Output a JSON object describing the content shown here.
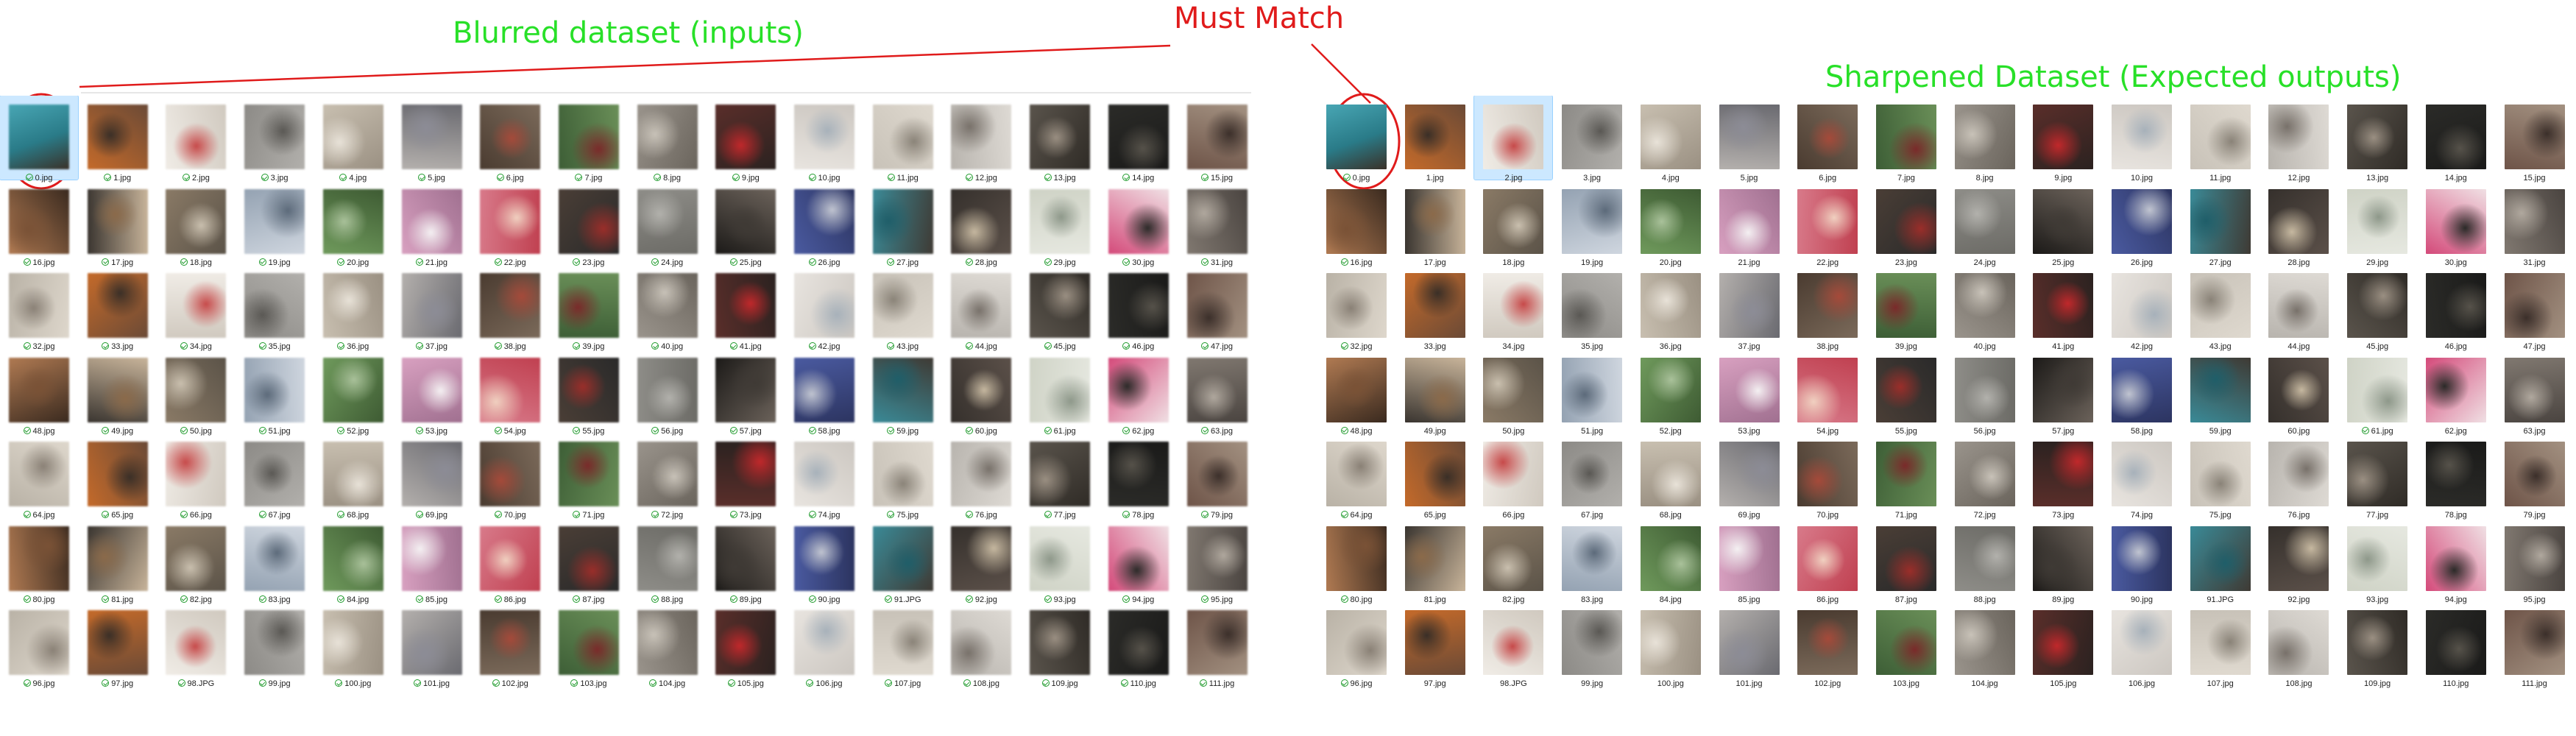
{
  "annotations": {
    "left_title": "Blurred dataset (inputs)",
    "center_title": "Must Match",
    "right_title": "Sharpened Dataset (Expected outputs)",
    "title_color": "#28e028",
    "match_color": "#e01b1b"
  },
  "explorer": {
    "status_icon": "sync-ok-icon",
    "status_color": "#1e9a2b",
    "selection_color": "#cce8ff"
  },
  "blurred_pane": {
    "files": [
      "0.jpg",
      "1.jpg",
      "2.jpg",
      "3.jpg",
      "4.jpg",
      "5.jpg",
      "6.jpg",
      "7.jpg",
      "8.jpg",
      "9.jpg",
      "10.jpg",
      "11.jpg",
      "12.jpg",
      "13.jpg",
      "14.jpg",
      "15.jpg",
      "16.jpg",
      "17.jpg",
      "18.jpg",
      "19.jpg",
      "20.jpg",
      "21.jpg",
      "22.jpg",
      "23.jpg",
      "24.jpg",
      "25.jpg",
      "26.jpg",
      "27.jpg",
      "28.jpg",
      "29.jpg",
      "30.jpg",
      "31.jpg",
      "32.jpg",
      "33.jpg",
      "34.jpg",
      "35.jpg",
      "36.jpg",
      "37.jpg",
      "38.jpg",
      "39.jpg",
      "40.jpg",
      "41.jpg",
      "42.jpg",
      "43.jpg",
      "44.jpg",
      "45.jpg",
      "46.jpg",
      "47.jpg",
      "48.jpg",
      "49.jpg",
      "50.jpg",
      "51.jpg",
      "52.jpg",
      "53.jpg",
      "54.jpg",
      "55.jpg",
      "56.jpg",
      "57.jpg",
      "58.jpg",
      "59.jpg",
      "60.jpg",
      "61.jpg",
      "62.jpg",
      "63.jpg",
      "64.jpg",
      "65.jpg",
      "66.jpg",
      "67.jpg",
      "68.jpg",
      "69.jpg",
      "70.jpg",
      "71.jpg",
      "72.jpg",
      "73.jpg",
      "74.jpg",
      "75.jpg",
      "76.jpg",
      "77.jpg",
      "78.jpg",
      "79.jpg",
      "80.jpg",
      "81.jpg",
      "82.jpg",
      "83.jpg",
      "84.jpg",
      "85.jpg",
      "86.jpg",
      "87.jpg",
      "88.jpg",
      "89.jpg",
      "90.jpg",
      "91.JPG",
      "92.jpg",
      "93.jpg",
      "94.jpg",
      "95.jpg",
      "96.jpg",
      "97.jpg",
      "98.JPG",
      "99.jpg",
      "100.jpg",
      "101.jpg",
      "102.jpg",
      "103.jpg",
      "104.jpg",
      "105.jpg",
      "106.jpg",
      "107.jpg",
      "108.jpg",
      "109.jpg",
      "110.jpg",
      "111.jpg"
    ],
    "selected_index": 0
  },
  "sharpened_pane": {
    "files": [
      "0.jpg",
      "1.jpg",
      "2.jpg",
      "3.jpg",
      "4.jpg",
      "5.jpg",
      "6.jpg",
      "7.jpg",
      "8.jpg",
      "9.jpg",
      "10.jpg",
      "11.jpg",
      "12.jpg",
      "13.jpg",
      "14.jpg",
      "15.jpg",
      "16.jpg",
      "17.jpg",
      "18.jpg",
      "19.jpg",
      "20.jpg",
      "21.jpg",
      "22.jpg",
      "23.jpg",
      "24.jpg",
      "25.jpg",
      "26.jpg",
      "27.jpg",
      "28.jpg",
      "29.jpg",
      "30.jpg",
      "31.jpg",
      "32.jpg",
      "33.jpg",
      "34.jpg",
      "35.jpg",
      "36.jpg",
      "37.jpg",
      "38.jpg",
      "39.jpg",
      "40.jpg",
      "41.jpg",
      "42.jpg",
      "43.jpg",
      "44.jpg",
      "45.jpg",
      "46.jpg",
      "47.jpg",
      "48.jpg",
      "49.jpg",
      "50.jpg",
      "51.jpg",
      "52.jpg",
      "53.jpg",
      "54.jpg",
      "55.jpg",
      "56.jpg",
      "57.jpg",
      "58.jpg",
      "59.jpg",
      "60.jpg",
      "61.jpg",
      "62.jpg",
      "63.jpg",
      "64.jpg",
      "65.jpg",
      "66.jpg",
      "67.jpg",
      "68.jpg",
      "69.jpg",
      "70.jpg",
      "71.jpg",
      "72.jpg",
      "73.jpg",
      "74.jpg",
      "75.jpg",
      "76.jpg",
      "77.jpg",
      "78.jpg",
      "79.jpg",
      "80.jpg",
      "81.jpg",
      "82.jpg",
      "83.jpg",
      "84.jpg",
      "85.jpg",
      "86.jpg",
      "87.jpg",
      "88.jpg",
      "89.jpg",
      "90.jpg",
      "91.JPG",
      "92.jpg",
      "93.jpg",
      "94.jpg",
      "95.jpg",
      "96.jpg",
      "97.jpg",
      "98.JPG",
      "99.jpg",
      "100.jpg",
      "101.jpg",
      "102.jpg",
      "103.jpg",
      "104.jpg",
      "105.jpg",
      "106.jpg",
      "107.jpg",
      "108.jpg",
      "109.jpg",
      "110.jpg",
      "111.jpg"
    ],
    "selected_index": 2
  }
}
